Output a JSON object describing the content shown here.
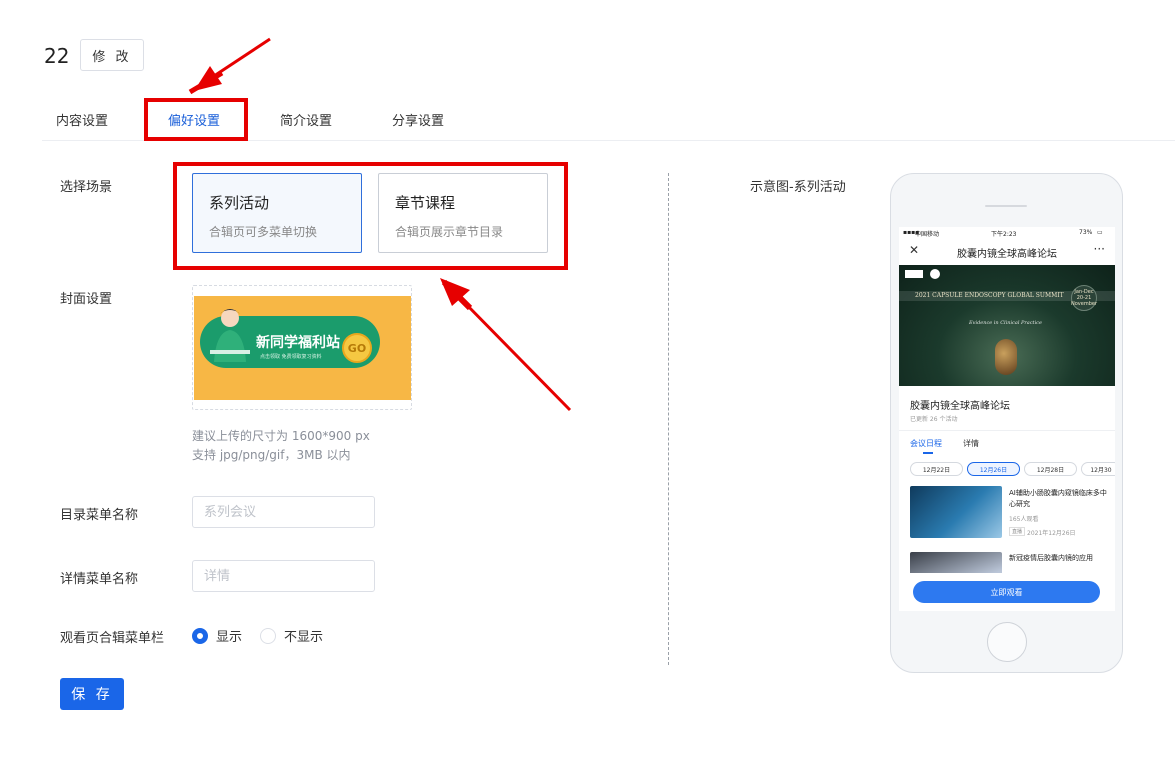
{
  "header": {
    "title": "22",
    "edit_label": "修 改"
  },
  "tabs": [
    {
      "label": "内容设置"
    },
    {
      "label": "偏好设置"
    },
    {
      "label": "简介设置"
    },
    {
      "label": "分享设置"
    }
  ],
  "active_tab_index": 1,
  "form": {
    "scene_label": "选择场景",
    "scene_options": [
      {
        "title": "系列活动",
        "desc": "合辑页可多菜单切换",
        "selected": true
      },
      {
        "title": "章节课程",
        "desc": "合辑页展示章节目录",
        "selected": false
      }
    ],
    "cover_label": "封面设置",
    "cover_image": {
      "title": "新同学福利站",
      "subtitle": "点击领取 免费领取复习资料",
      "go": "GO"
    },
    "cover_hint_1": "建议上传的尺寸为 1600*900 px",
    "cover_hint_2": "支持 jpg/png/gif，3MB 以内",
    "catalog_menu_label": "目录菜单名称",
    "catalog_menu_placeholder": "系列会议",
    "detail_menu_label": "详情菜单名称",
    "detail_menu_placeholder": "详情",
    "watch_menu_label": "观看页合辑菜单栏",
    "watch_menu_options": [
      {
        "label": "显示",
        "checked": true
      },
      {
        "label": "不显示",
        "checked": false
      }
    ],
    "save_label": "保 存"
  },
  "preview": {
    "label": "示意图-系列活动",
    "status_carrier": "中国移动",
    "status_time": "下午2:23",
    "status_battery": "73%",
    "nav_title": "胶囊内镜全球高峰论坛",
    "hero_title": "2021  CAPSULE ENDOSCOPY GLOBAL SUMMIT",
    "hero_tagline": "Evidence in Clinical Practice",
    "hero_badge": "Jan-Dec 20-21 November",
    "page_title": "胶囊内镜全球高峰论坛",
    "page_meta": "已更新 26 个活动",
    "tabs": [
      "会议日程",
      "详情"
    ],
    "dates": [
      "12月22日",
      "12月26日",
      "12月28日",
      "12月30"
    ],
    "active_date_index": 1,
    "items": [
      {
        "title": "AI辅助小肠胶囊内窥镜临床多中心研究",
        "views": "165人观看",
        "tag": "直播",
        "date": "2021年12月26日"
      },
      {
        "title": "新冠疫情后胶囊内镜的应用"
      }
    ],
    "watch_button": "立即观看"
  },
  "colors": {
    "primary": "#1a66e8",
    "annotation": "#e60000"
  }
}
